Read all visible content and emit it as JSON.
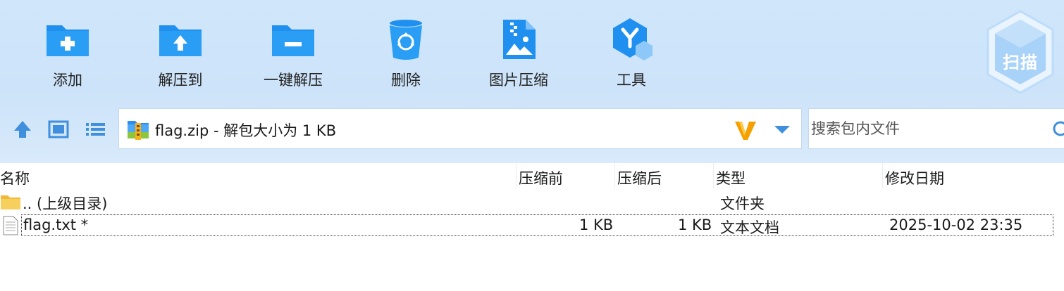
{
  "toolbar": {
    "add_label": "添加",
    "extract_to_label": "解压到",
    "one_click_extract_label": "一键解压",
    "delete_label": "删除",
    "image_compress_label": "图片压缩",
    "tools_label": "工具",
    "scan_label": "扫描"
  },
  "address": {
    "text": "flag.zip - 解包大小为 1 KB",
    "icon": "zip-archive-icon"
  },
  "search": {
    "placeholder": "搜索包内文件",
    "value": ""
  },
  "columns": {
    "name": "名称",
    "size_before": "压缩前",
    "size_after": "压缩后",
    "type": "类型",
    "modified": "修改日期"
  },
  "rows": [
    {
      "name": ".. (上级目录)",
      "size_before": "",
      "size_after": "",
      "type": "文件夹",
      "modified": "",
      "icon": "folder-icon"
    },
    {
      "name": "flag.txt *",
      "size_before": "1 KB",
      "size_after": "1 KB",
      "type": "文本文档",
      "modified": "2025-10-02 23:35",
      "icon": "text-file-icon"
    }
  ],
  "colors": {
    "toolbar_bg": "#cfe6fb",
    "icon_blue": "#1f8ff0",
    "accent_orange": "#f5a000"
  }
}
